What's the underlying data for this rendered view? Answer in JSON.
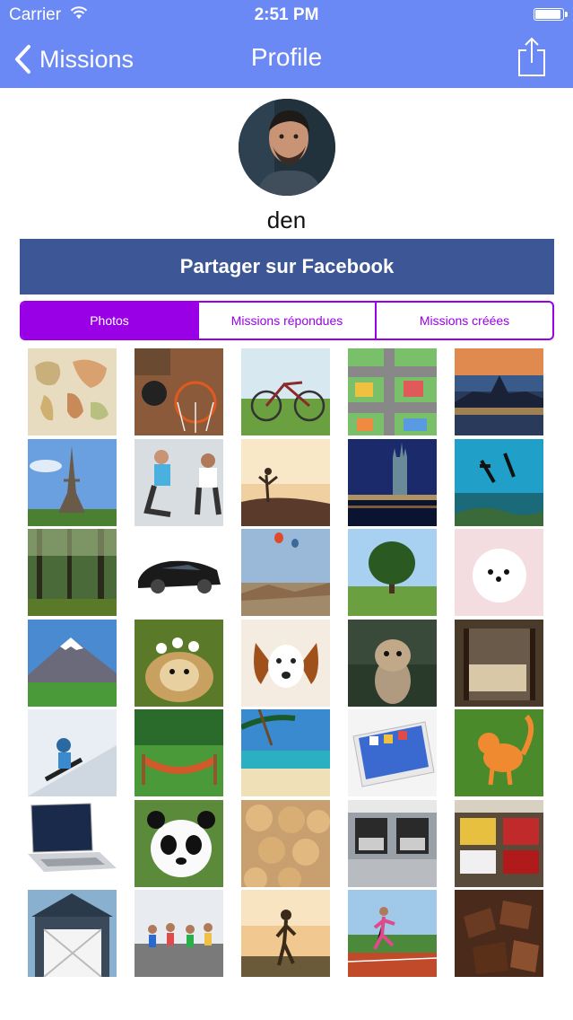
{
  "status_bar": {
    "carrier": "Carrier",
    "time": "2:51 PM",
    "battery_level": 1.0
  },
  "nav": {
    "back_label": "Missions",
    "title": "Profile"
  },
  "profile": {
    "username": "den"
  },
  "facebook_button": {
    "label": "Partager sur Facebook"
  },
  "tabs": [
    {
      "label": "Photos",
      "active": true
    },
    {
      "label": "Missions répondues",
      "active": false
    },
    {
      "label": "Missions créées",
      "active": false
    }
  ],
  "photos": [
    {
      "name": "world-map-photo"
    },
    {
      "name": "basketball-hoop-photo"
    },
    {
      "name": "bicycle-grass-photo"
    },
    {
      "name": "city-map-toy-photo"
    },
    {
      "name": "rome-sunset-photo"
    },
    {
      "name": "eiffel-tower-photo"
    },
    {
      "name": "fitness-stretch-photo"
    },
    {
      "name": "yoga-sunset-photo"
    },
    {
      "name": "cologne-cathedral-photo"
    },
    {
      "name": "scuba-divers-photo"
    },
    {
      "name": "forest-photo"
    },
    {
      "name": "sports-car-photo"
    },
    {
      "name": "hot-air-balloons-photo"
    },
    {
      "name": "tree-meadow-photo"
    },
    {
      "name": "white-puppy-photo"
    },
    {
      "name": "snowy-mountain-photo"
    },
    {
      "name": "guinea-pig-photo"
    },
    {
      "name": "spaniel-puppy-photo"
    },
    {
      "name": "kitten-photo"
    },
    {
      "name": "bedroom-photo"
    },
    {
      "name": "snowboarder-photo"
    },
    {
      "name": "hammock-photo"
    },
    {
      "name": "tropical-beach-photo"
    },
    {
      "name": "smartphone-photo"
    },
    {
      "name": "orange-kitten-photo"
    },
    {
      "name": "laptop-photo"
    },
    {
      "name": "panda-photo"
    },
    {
      "name": "cookies-photo"
    },
    {
      "name": "garage-photo"
    },
    {
      "name": "car-garage-photo"
    },
    {
      "name": "barn-door-photo"
    },
    {
      "name": "runners-group-photo"
    },
    {
      "name": "runner-sunset-photo"
    },
    {
      "name": "track-runner-photo"
    },
    {
      "name": "chocolate-photo"
    }
  ]
}
